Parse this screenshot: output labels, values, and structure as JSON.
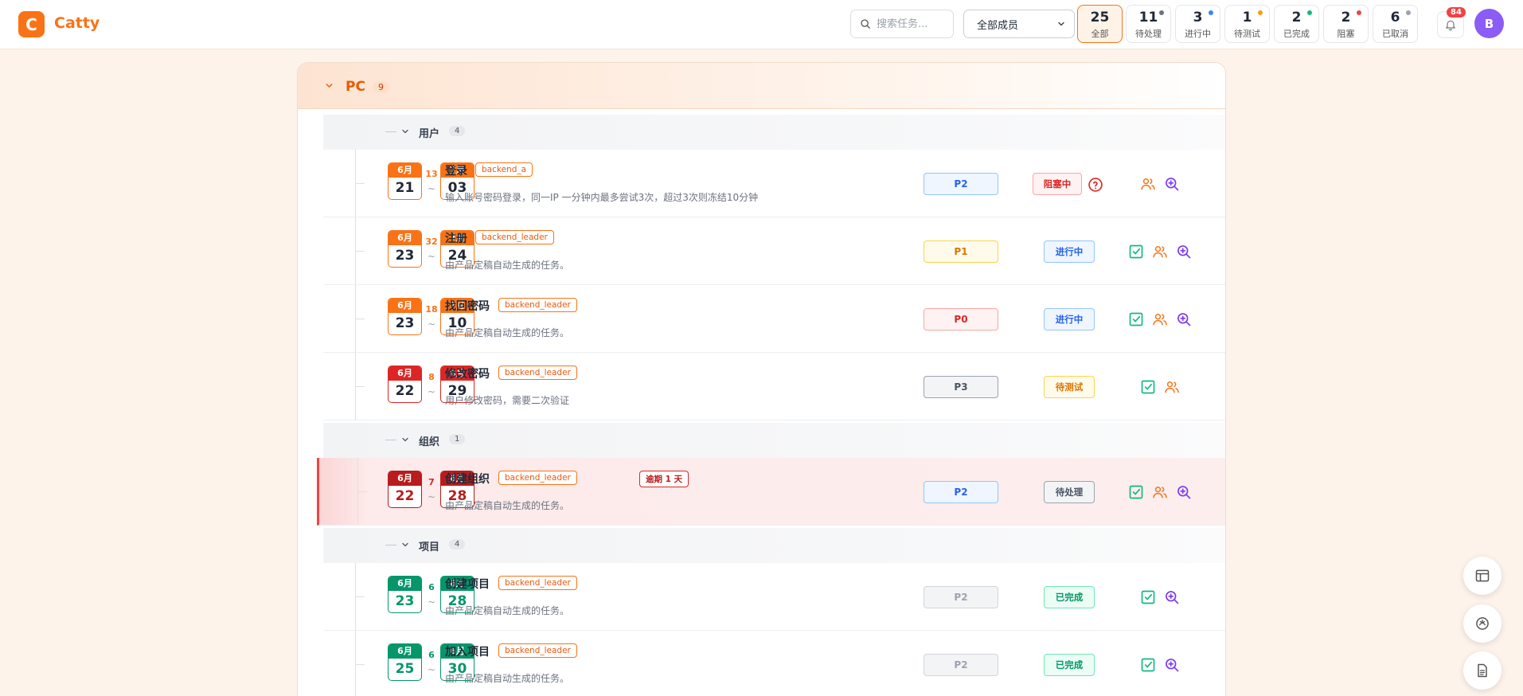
{
  "app": {
    "logo_letter": "C",
    "name": "Catty"
  },
  "header": {
    "search_placeholder": "搜索任务...",
    "member_filter": "全部成员",
    "chips": [
      {
        "count": "25",
        "label": "全部"
      },
      {
        "count": "11",
        "label": "待处理",
        "dot": "#6b7280"
      },
      {
        "count": "3",
        "label": "进行中",
        "dot": "#3b82f6"
      },
      {
        "count": "1",
        "label": "待测试",
        "dot": "#f59e0b"
      },
      {
        "count": "2",
        "label": "已完成",
        "dot": "#10b981"
      },
      {
        "count": "2",
        "label": "阻塞",
        "dot": "#ef4444"
      },
      {
        "count": "6",
        "label": "已取消",
        "dot": "#9ca3af"
      }
    ],
    "notification_count": "84",
    "avatar_letter": "B"
  },
  "project": {
    "name": "PC",
    "count": "9"
  },
  "groups": [
    {
      "name": "用户",
      "count": "4"
    },
    {
      "name": "组织",
      "count": "1"
    },
    {
      "name": "项目",
      "count": "4"
    }
  ],
  "tasks": [
    {
      "start_month": "6月",
      "start_day": "21",
      "duration": "13",
      "end_month": "7月",
      "end_day": "03",
      "title": "登录",
      "assignee": "backend_a",
      "desc": "输入账号密码登录，同一IP 一分钟内最多尝试3次，超过3次则冻结10分钟",
      "priority": "P2",
      "status": "阻塞中"
    },
    {
      "start_month": "6月",
      "start_day": "23",
      "duration": "32",
      "end_month": "7月",
      "end_day": "24",
      "title": "注册",
      "assignee": "backend_leader",
      "desc": "由产品定稿自动生成的任务。",
      "priority": "P1",
      "status": "进行中"
    },
    {
      "start_month": "6月",
      "start_day": "23",
      "duration": "18",
      "end_month": "7月",
      "end_day": "10",
      "title": "找回密码",
      "assignee": "backend_leader",
      "desc": "由产品定稿自动生成的任务。",
      "priority": "P0",
      "status": "进行中"
    },
    {
      "start_month": "6月",
      "start_day": "22",
      "duration": "8",
      "end_month": "6月",
      "end_day": "29",
      "title": "修改密码",
      "assignee": "backend_leader",
      "desc": "用户修改密码，需要二次验证",
      "priority": "P3",
      "status": "待测试"
    },
    {
      "start_month": "6月",
      "start_day": "22",
      "duration": "7",
      "end_month": "6月",
      "end_day": "28",
      "title": "创建组织",
      "assignee": "backend_leader",
      "overdue": "逾期 1 天",
      "desc": "由产品定稿自动生成的任务。",
      "priority": "P2",
      "status": "待处理"
    },
    {
      "start_month": "6月",
      "start_day": "23",
      "duration": "6",
      "end_month": "6月",
      "end_day": "28",
      "title": "创建项目",
      "assignee": "backend_leader",
      "desc": "由产品定稿自动生成的任务。",
      "priority": "P2",
      "status": "已完成"
    },
    {
      "start_month": "6月",
      "start_day": "25",
      "duration": "6",
      "end_month": "6月",
      "end_day": "30",
      "title": "加入项目",
      "assignee": "backend_leader",
      "desc": "由产品定稿自动生成的任务。",
      "priority": "P2",
      "status": "已完成"
    }
  ],
  "colors": {
    "accent": "#f97316",
    "blocked": "#dc2626",
    "done": "#059669",
    "in_progress": "#2563eb",
    "testing": "#d97706"
  }
}
